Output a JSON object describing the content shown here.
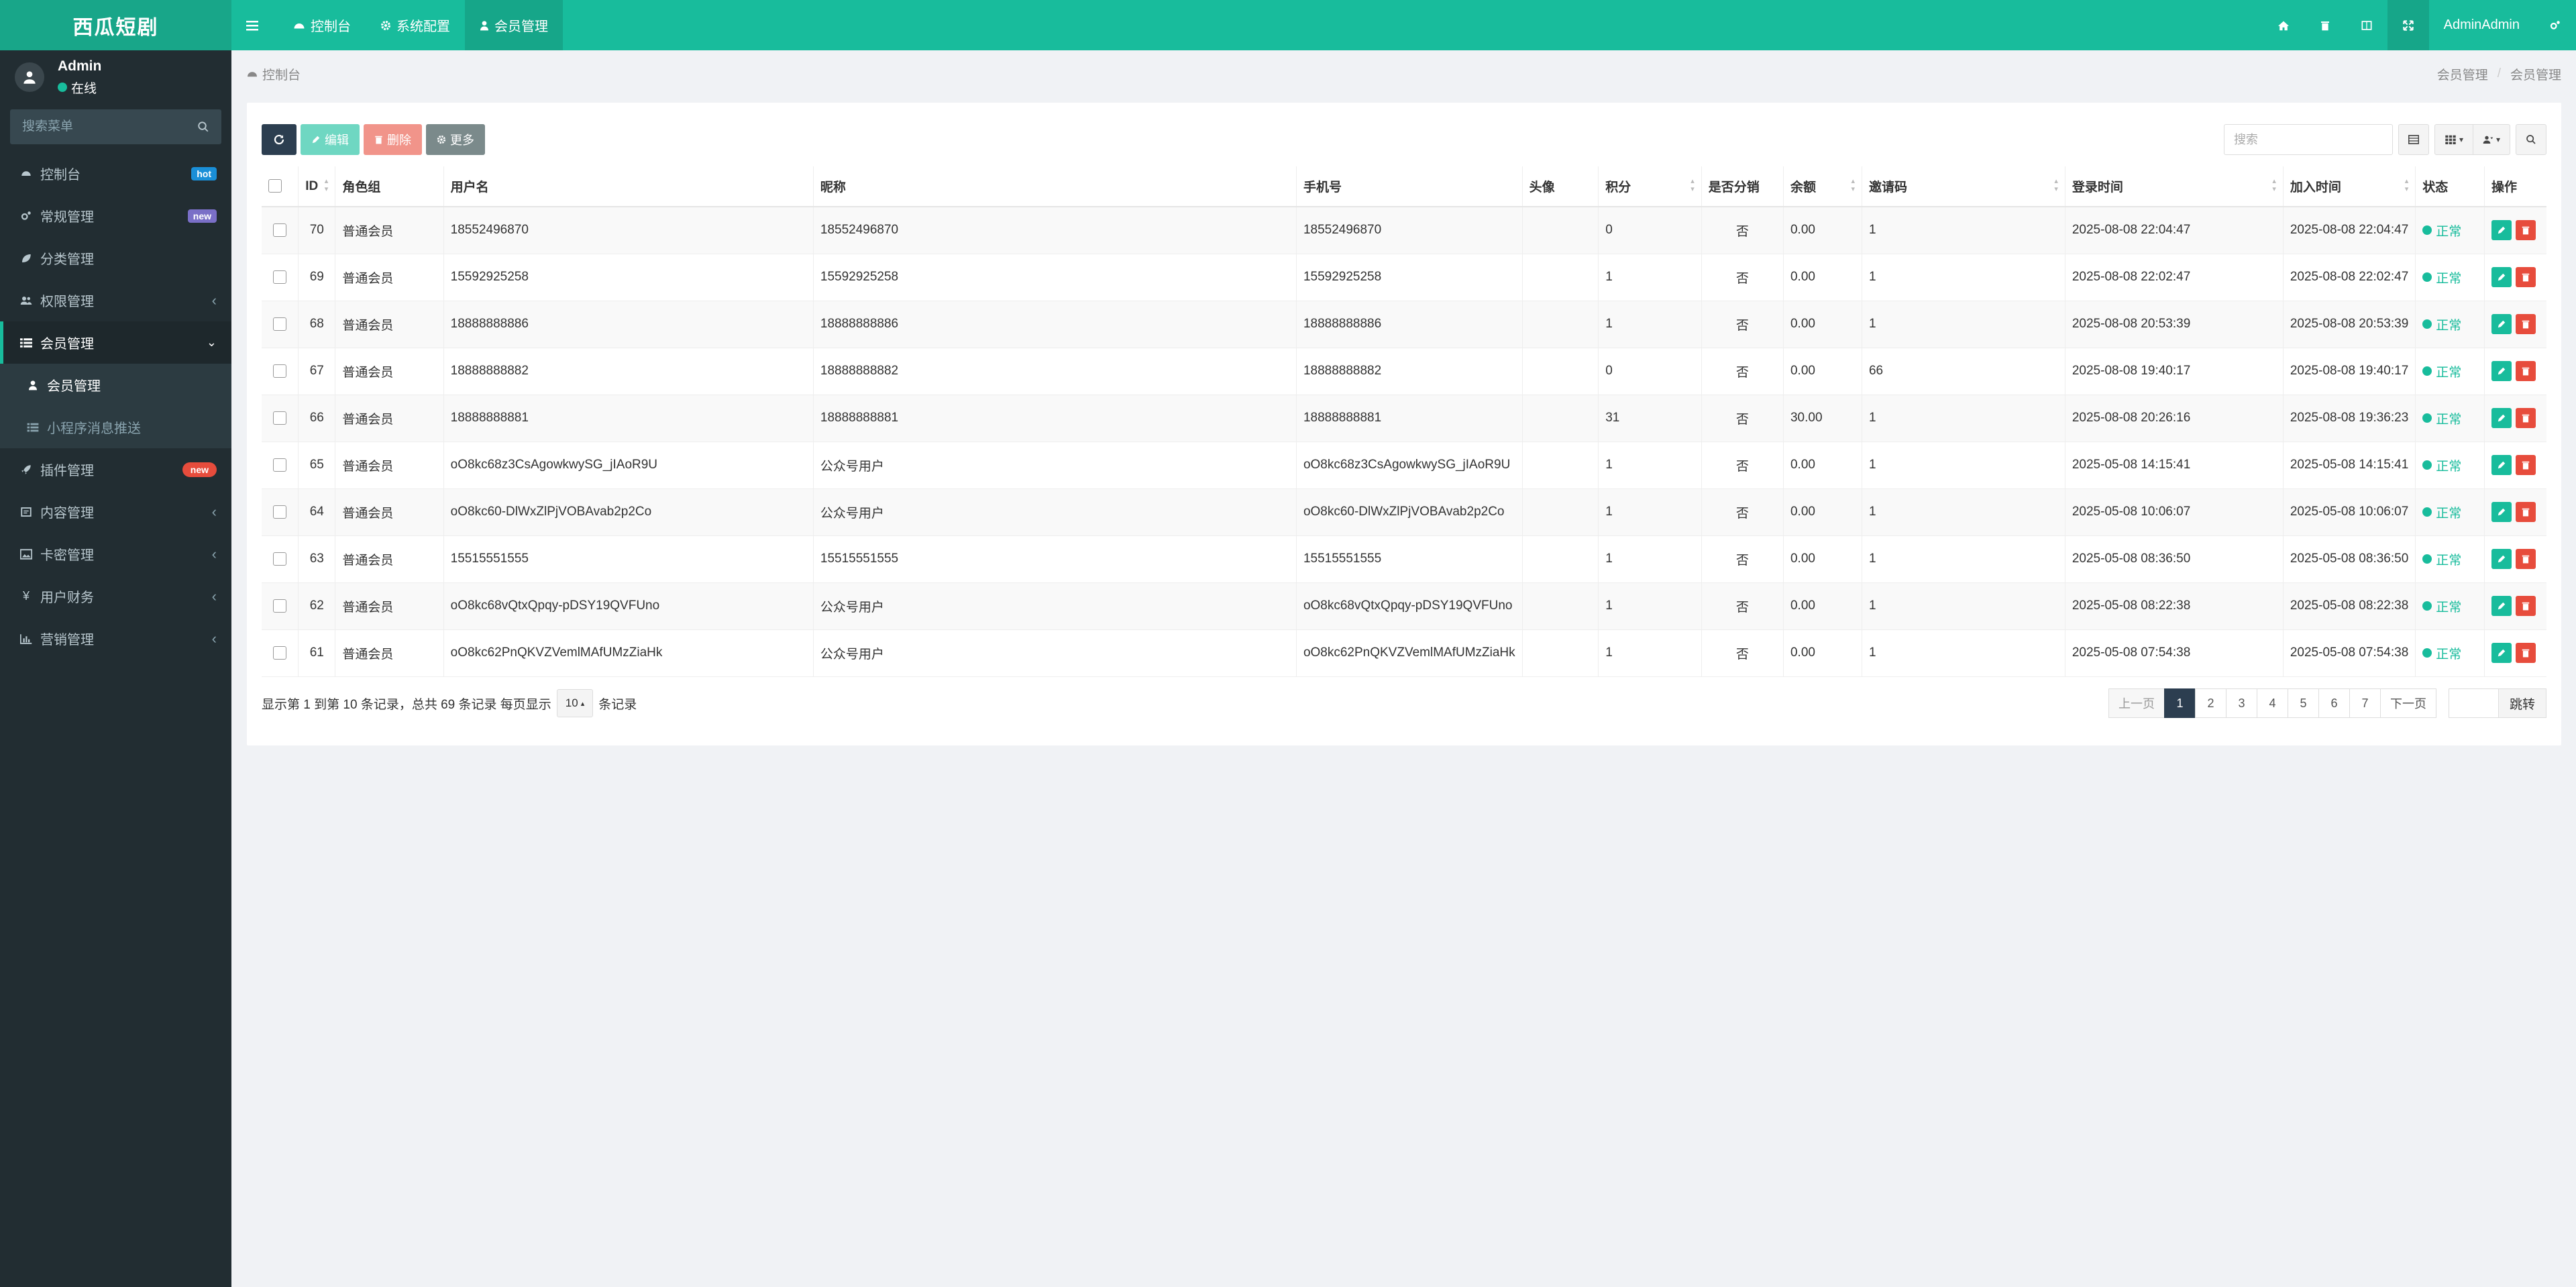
{
  "app": {
    "title": "西瓜短剧"
  },
  "colors": {
    "brand": "#18bc9c",
    "sidebar_bg": "#222d32",
    "dark_btn": "#2c3e50",
    "danger": "#e74c3c"
  },
  "user": {
    "name": "Admin",
    "status": "在线"
  },
  "sidebar": {
    "search_placeholder": "搜索菜单",
    "items": [
      {
        "label": "控制台",
        "icon": "dashboard-icon",
        "badge": "hot"
      },
      {
        "label": "常规管理",
        "icon": "cogs-icon",
        "badge": "new"
      },
      {
        "label": "分类管理",
        "icon": "leaf-icon"
      },
      {
        "label": "权限管理",
        "icon": "users-icon"
      },
      {
        "label": "会员管理",
        "icon": "list-icon"
      },
      {
        "label": "插件管理",
        "icon": "rocket-icon",
        "badge": "new"
      },
      {
        "label": "内容管理",
        "icon": "file-icon"
      },
      {
        "label": "卡密管理",
        "icon": "image-icon"
      },
      {
        "label": "用户财务",
        "icon": "yen-icon"
      },
      {
        "label": "营销管理",
        "icon": "bar-chart-icon"
      }
    ],
    "submenu": [
      {
        "label": "会员管理",
        "icon": "user-icon"
      },
      {
        "label": "小程序消息推送",
        "icon": "list-icon"
      }
    ]
  },
  "topnav": {
    "tabs": [
      {
        "label": "控制台",
        "icon": "dashboard-icon"
      },
      {
        "label": "系统配置",
        "icon": "cog-icon"
      },
      {
        "label": "会员管理",
        "icon": "user-icon"
      }
    ],
    "user_label": "AdminAdmin"
  },
  "breadcrumb": {
    "left": "控制台",
    "right": [
      "会员管理",
      "会员管理"
    ]
  },
  "toolbar": {
    "edit": "编辑",
    "delete": "删除",
    "more": "更多",
    "search_placeholder": "搜索"
  },
  "table": {
    "columns": [
      "ID",
      "角色组",
      "用户名",
      "昵称",
      "手机号",
      "头像",
      "积分",
      "是否分销",
      "余额",
      "邀请码",
      "登录时间",
      "加入时间",
      "状态",
      "操作"
    ],
    "rows": [
      {
        "id": "70",
        "group": "普通会员",
        "username": "18552496870",
        "nickname": "18552496870",
        "mobile": "18552496870",
        "score": "0",
        "distrib": "否",
        "balance": "0.00",
        "invite": "1",
        "login": "2025-08-08 22:04:47",
        "join": "2025-08-08 22:04:47",
        "status": "正常"
      },
      {
        "id": "69",
        "group": "普通会员",
        "username": "15592925258",
        "nickname": "15592925258",
        "mobile": "15592925258",
        "score": "1",
        "distrib": "否",
        "balance": "0.00",
        "invite": "1",
        "login": "2025-08-08 22:02:47",
        "join": "2025-08-08 22:02:47",
        "status": "正常"
      },
      {
        "id": "68",
        "group": "普通会员",
        "username": "18888888886",
        "nickname": "18888888886",
        "mobile": "18888888886",
        "score": "1",
        "distrib": "否",
        "balance": "0.00",
        "invite": "1",
        "login": "2025-08-08 20:53:39",
        "join": "2025-08-08 20:53:39",
        "status": "正常"
      },
      {
        "id": "67",
        "group": "普通会员",
        "username": "18888888882",
        "nickname": "18888888882",
        "mobile": "18888888882",
        "score": "0",
        "distrib": "否",
        "balance": "0.00",
        "invite": "66",
        "login": "2025-08-08 19:40:17",
        "join": "2025-08-08 19:40:17",
        "status": "正常"
      },
      {
        "id": "66",
        "group": "普通会员",
        "username": "18888888881",
        "nickname": "18888888881",
        "mobile": "18888888881",
        "score": "31",
        "distrib": "否",
        "balance": "30.00",
        "invite": "1",
        "login": "2025-08-08 20:26:16",
        "join": "2025-08-08 19:36:23",
        "status": "正常"
      },
      {
        "id": "65",
        "group": "普通会员",
        "username": "oO8kc68z3CsAgowkwySG_jIAoR9U",
        "nickname": "公众号用户",
        "mobile": "oO8kc68z3CsAgowkwySG_jIAoR9U",
        "score": "1",
        "distrib": "否",
        "balance": "0.00",
        "invite": "1",
        "login": "2025-05-08 14:15:41",
        "join": "2025-05-08 14:15:41",
        "status": "正常"
      },
      {
        "id": "64",
        "group": "普通会员",
        "username": "oO8kc60-DlWxZlPjVOBAvab2p2Co",
        "nickname": "公众号用户",
        "mobile": "oO8kc60-DlWxZlPjVOBAvab2p2Co",
        "score": "1",
        "distrib": "否",
        "balance": "0.00",
        "invite": "1",
        "login": "2025-05-08 10:06:07",
        "join": "2025-05-08 10:06:07",
        "status": "正常"
      },
      {
        "id": "63",
        "group": "普通会员",
        "username": "15515551555",
        "nickname": "15515551555",
        "mobile": "15515551555",
        "score": "1",
        "distrib": "否",
        "balance": "0.00",
        "invite": "1",
        "login": "2025-05-08 08:36:50",
        "join": "2025-05-08 08:36:50",
        "status": "正常"
      },
      {
        "id": "62",
        "group": "普通会员",
        "username": "oO8kc68vQtxQpqy-pDSY19QVFUno",
        "nickname": "公众号用户",
        "mobile": "oO8kc68vQtxQpqy-pDSY19QVFUno",
        "score": "1",
        "distrib": "否",
        "balance": "0.00",
        "invite": "1",
        "login": "2025-05-08 08:22:38",
        "join": "2025-05-08 08:22:38",
        "status": "正常"
      },
      {
        "id": "61",
        "group": "普通会员",
        "username": "oO8kc62PnQKVZVemlMAfUMzZiaHk",
        "nickname": "公众号用户",
        "mobile": "oO8kc62PnQKVZVemlMAfUMzZiaHk",
        "score": "1",
        "distrib": "否",
        "balance": "0.00",
        "invite": "1",
        "login": "2025-05-08 07:54:38",
        "join": "2025-05-08 07:54:38",
        "status": "正常"
      }
    ]
  },
  "footer": {
    "summary": "显示第 1 到第 10 条记录，总共 69 条记录 每页显示",
    "page_size": "10",
    "suffix": "条记录",
    "prev": "上一页",
    "next": "下一页",
    "pages": [
      "1",
      "2",
      "3",
      "4",
      "5",
      "6",
      "7"
    ],
    "jump": "跳转"
  }
}
